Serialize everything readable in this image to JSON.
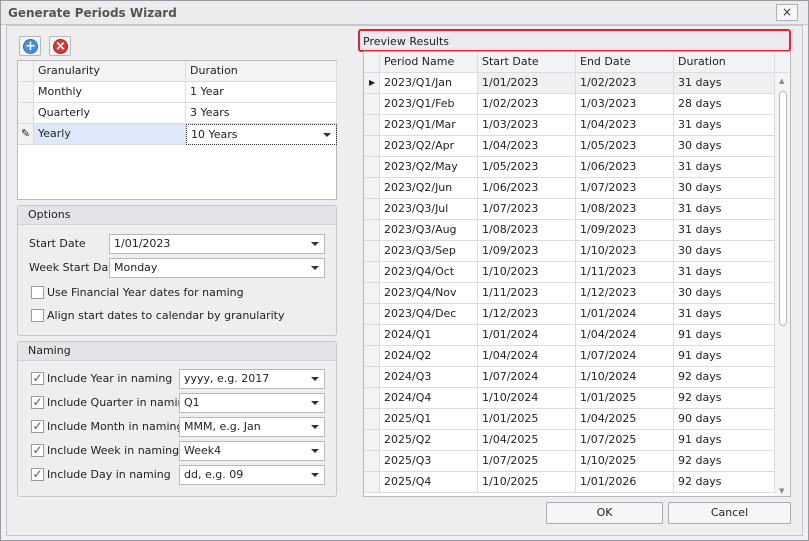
{
  "window": {
    "title": "Generate Periods Wizard",
    "close": "×"
  },
  "toolbar": {
    "add_icon": "plus-circle-icon",
    "remove_icon": "x-circle-icon"
  },
  "granularity_grid": {
    "columns": [
      "Granularity",
      "Duration"
    ],
    "rows": [
      {
        "granularity": "Monthly",
        "duration": "1 Year"
      },
      {
        "granularity": "Quarterly",
        "duration": "3 Years"
      },
      {
        "granularity": "Yearly",
        "duration": "10 Years"
      }
    ]
  },
  "options": {
    "title": "Options",
    "start_date_label": "Start Date",
    "start_date": "1/01/2023",
    "week_start_label": "Week Start Day",
    "week_start": "Monday",
    "financial_year": {
      "label": "Use Financial Year dates for naming",
      "checked": false
    },
    "align": {
      "label": "Align start dates to calendar by granularity",
      "checked": false
    }
  },
  "naming": {
    "title": "Naming",
    "items": [
      {
        "label": "Include Year in naming",
        "value": "yyyy, e.g. 2017",
        "checked": true
      },
      {
        "label": "Include Quarter in naming",
        "value": "Q1",
        "checked": true
      },
      {
        "label": "Include Month in naming",
        "value": "MMM, e.g. Jan",
        "checked": true
      },
      {
        "label": "Include Week in naming",
        "value": "Week4",
        "checked": true
      },
      {
        "label": "Include Day in naming",
        "value": "dd, e.g. 09",
        "checked": true
      }
    ]
  },
  "preview": {
    "title": "Preview Results",
    "highlight_color": "#e8202a",
    "columns": [
      "Period Name",
      "Start Date",
      "End Date",
      "Duration"
    ],
    "rows": [
      [
        "2023/Q1/Jan",
        "1/01/2023",
        "1/02/2023",
        "31 days"
      ],
      [
        "2023/Q1/Feb",
        "1/02/2023",
        "1/03/2023",
        "28 days"
      ],
      [
        "2023/Q1/Mar",
        "1/03/2023",
        "1/04/2023",
        "31 days"
      ],
      [
        "2023/Q2/Apr",
        "1/04/2023",
        "1/05/2023",
        "30 days"
      ],
      [
        "2023/Q2/May",
        "1/05/2023",
        "1/06/2023",
        "31 days"
      ],
      [
        "2023/Q2/Jun",
        "1/06/2023",
        "1/07/2023",
        "30 days"
      ],
      [
        "2023/Q3/Jul",
        "1/07/2023",
        "1/08/2023",
        "31 days"
      ],
      [
        "2023/Q3/Aug",
        "1/08/2023",
        "1/09/2023",
        "31 days"
      ],
      [
        "2023/Q3/Sep",
        "1/09/2023",
        "1/10/2023",
        "30 days"
      ],
      [
        "2023/Q4/Oct",
        "1/10/2023",
        "1/11/2023",
        "31 days"
      ],
      [
        "2023/Q4/Nov",
        "1/11/2023",
        "1/12/2023",
        "30 days"
      ],
      [
        "2023/Q4/Dec",
        "1/12/2023",
        "1/01/2024",
        "31 days"
      ],
      [
        "2024/Q1",
        "1/01/2024",
        "1/04/2024",
        "91 days"
      ],
      [
        "2024/Q2",
        "1/04/2024",
        "1/07/2024",
        "91 days"
      ],
      [
        "2024/Q3",
        "1/07/2024",
        "1/10/2024",
        "92 days"
      ],
      [
        "2024/Q4",
        "1/10/2024",
        "1/01/2025",
        "92 days"
      ],
      [
        "2025/Q1",
        "1/01/2025",
        "1/04/2025",
        "90 days"
      ],
      [
        "2025/Q2",
        "1/04/2025",
        "1/07/2025",
        "91 days"
      ],
      [
        "2025/Q3",
        "1/07/2025",
        "1/10/2025",
        "92 days"
      ],
      [
        "2025/Q4",
        "1/10/2025",
        "1/01/2026",
        "92 days"
      ]
    ]
  },
  "buttons": {
    "ok": "OK",
    "cancel": "Cancel"
  }
}
